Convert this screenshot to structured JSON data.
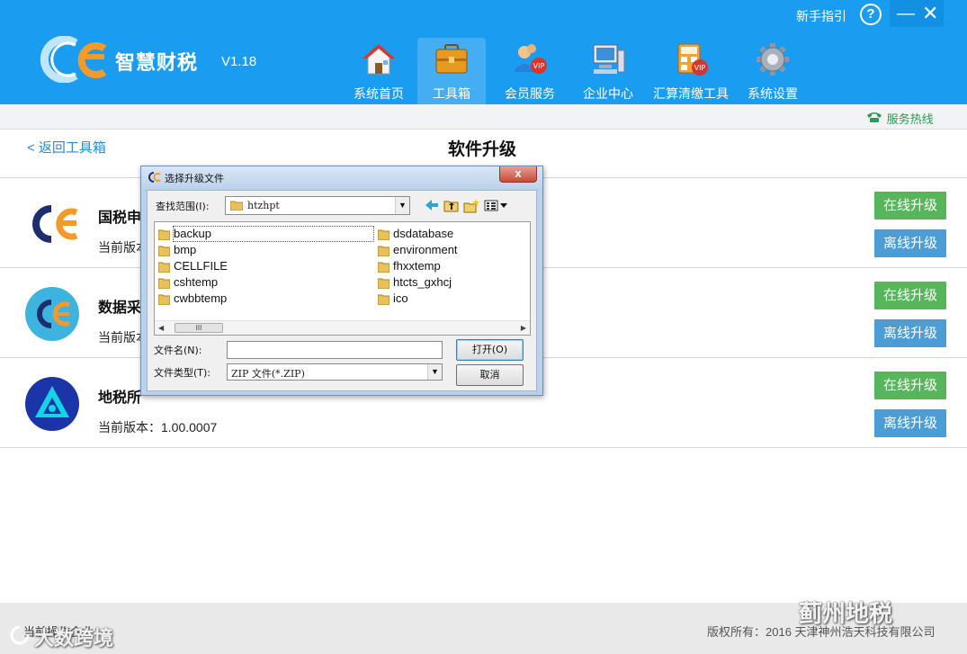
{
  "header": {
    "brand_name": "智慧财税",
    "version": "V1.18",
    "help_link": "新手指引",
    "help_icon_glyph": "?",
    "minimize_glyph": "—",
    "close_glyph": "✕",
    "nav": [
      {
        "label": "系统首页",
        "icon": "house-icon",
        "active": false
      },
      {
        "label": "工具箱",
        "icon": "toolbox-icon",
        "active": true
      },
      {
        "label": "会员服务",
        "icon": "vip-member-icon",
        "active": false
      },
      {
        "label": "企业中心",
        "icon": "computer-icon",
        "active": false
      },
      {
        "label": "汇算清缴工具",
        "icon": "calculator-vip-icon",
        "active": false
      },
      {
        "label": "系统设置",
        "icon": "gear-icon",
        "active": false
      }
    ],
    "bg_color": "#1a9df0"
  },
  "hotline": {
    "label": "服务热线"
  },
  "page": {
    "back_link": "< 返回工具箱",
    "title": "软件升级"
  },
  "software": [
    {
      "name": "国税申",
      "version_text": "当前版本",
      "online_btn": "在线升级",
      "offline_btn": "离线升级",
      "logo": "gc-logo"
    },
    {
      "name": "数据采",
      "version_text": "当前版本",
      "online_btn": "在线升级",
      "offline_btn": "离线升级",
      "logo": "gc-round-logo"
    },
    {
      "name": "地税所",
      "version_text": "当前版本：1.00.0007",
      "online_btn": "在线升级",
      "offline_btn": "离线升级",
      "logo": "triangle-logo"
    }
  ],
  "footer": {
    "left": "当前操作企业：",
    "copyright": "版权所有：2016 天津神州浩天科技有限公司"
  },
  "watermarks": {
    "wechat": "蓟州地税",
    "bottom_left": "大数跨境"
  },
  "dialog": {
    "title": "选择升级文件",
    "close_glyph": "x",
    "look_in_label": "查找范围(I):",
    "look_in_value": "htzhpt",
    "files_col1": [
      "backup",
      "bmp",
      "CELLFILE",
      "cshtemp",
      "cwbbtemp"
    ],
    "files_col2": [
      "dsdatabase",
      "environment",
      "fhxxtemp",
      "htcts_gxhcj",
      "ico"
    ],
    "selected_file": "backup",
    "scroll_thumb": "III",
    "filename_label": "文件名(N):",
    "filename_value": "",
    "filetype_label": "文件类型(T):",
    "filetype_value": "ZIP 文件(*.ZIP)",
    "open_btn": "打开(O)",
    "cancel_btn": "取消"
  },
  "colors": {
    "green_button": "#57b55b",
    "blue_button": "#4c9cd6",
    "link": "#2b8ad8",
    "hotline": "#2a9b58"
  }
}
